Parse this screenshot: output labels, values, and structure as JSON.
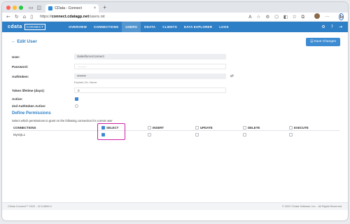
{
  "browser": {
    "tab_title": "CData - Connect",
    "tab_close": "×",
    "new_tab": "+",
    "url_prefix": "https://",
    "url_host": "connect.cdatagp.net",
    "url_path": "/users.rst",
    "traffic_colors": [
      "#ff5f57",
      "#febc2e",
      "#28c840"
    ]
  },
  "app": {
    "logo": "cdata",
    "logo_badge": "CONNECT",
    "menu": [
      "OVERVIEW",
      "CONNECTIONS",
      "USERS",
      "ODATA",
      "CLIENTS",
      "DATA EXPLORER",
      "LOGS"
    ],
    "active_menu": "USERS",
    "accent": "#2f7fc6"
  },
  "page": {
    "back_label": "Edit User",
    "save_label": "Save Changes",
    "fields": {
      "user_label": "User:",
      "user_value": "SalesforceConnect",
      "password_label": "Password:",
      "password_value": "········",
      "authtoken_label": "Authtoken:",
      "authtoken_value": "••••••••",
      "authtoken_sub": "Expires On: Never",
      "lifetime_label": "Token lifetime (days):",
      "lifetime_value": "0",
      "active_label": "Active:",
      "active_checked": true,
      "second_token_label": "2nd Authtoken Active:",
      "second_token_checked": false
    },
    "permissions": {
      "title": "Define Permissions",
      "description": "Select which permissions to grant on the following connection for current user",
      "columns": [
        "CONNECTIONS",
        "SELECT",
        "INSERT",
        "UPDATE",
        "DELETE",
        "EXECUTE"
      ],
      "rows": [
        {
          "name": "MySQL1",
          "select": true,
          "insert": false,
          "update": false,
          "delete": false,
          "execute": false
        }
      ]
    }
  },
  "footer": {
    "left": "CData Connect™ 2022 - 22.0.8899.0",
    "right": "© 2022 CData Software, Inc. - All Rights Reserved."
  },
  "highlight_color": "#d01fa7"
}
